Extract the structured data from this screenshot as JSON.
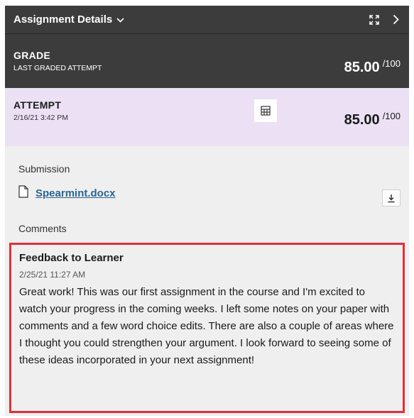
{
  "header": {
    "title": "Assignment Details",
    "title_chevron": "chevron-down-icon",
    "expand_icon": "expand-icon",
    "next_icon": "chevron-right-icon"
  },
  "grade": {
    "title": "GRADE",
    "subtitle": "LAST GRADED ATTEMPT",
    "score": "85.00",
    "denominator": "/100"
  },
  "attempt": {
    "title": "ATTEMPT",
    "date": "2/16/21 3:42 PM",
    "score": "85.00",
    "denominator": "/100",
    "grid_icon": "table-grid-icon"
  },
  "submission": {
    "label": "Submission",
    "file_name": "Spearmint.docx",
    "file_icon": "document-icon",
    "download_icon": "download-icon"
  },
  "comments": {
    "label": "Comments",
    "feedback_title": "Feedback to Learner",
    "feedback_date": "2/25/21 11:27 AM",
    "feedback_text": "Great work! This was our first assignment in the course and I'm excited to watch your progress in the coming weeks. I left some notes on your paper with comments and a few word choice edits. There are also a couple of areas where I thought you could strengthen your argument. I look forward to seeing some of these ideas incorporated in your next assignment!"
  },
  "colors": {
    "header_bg": "#3c3c3c",
    "attempt_bg": "#ece0f5",
    "panel_bg": "#efefef",
    "link": "#2a6592",
    "highlight_border": "#e0303a"
  }
}
